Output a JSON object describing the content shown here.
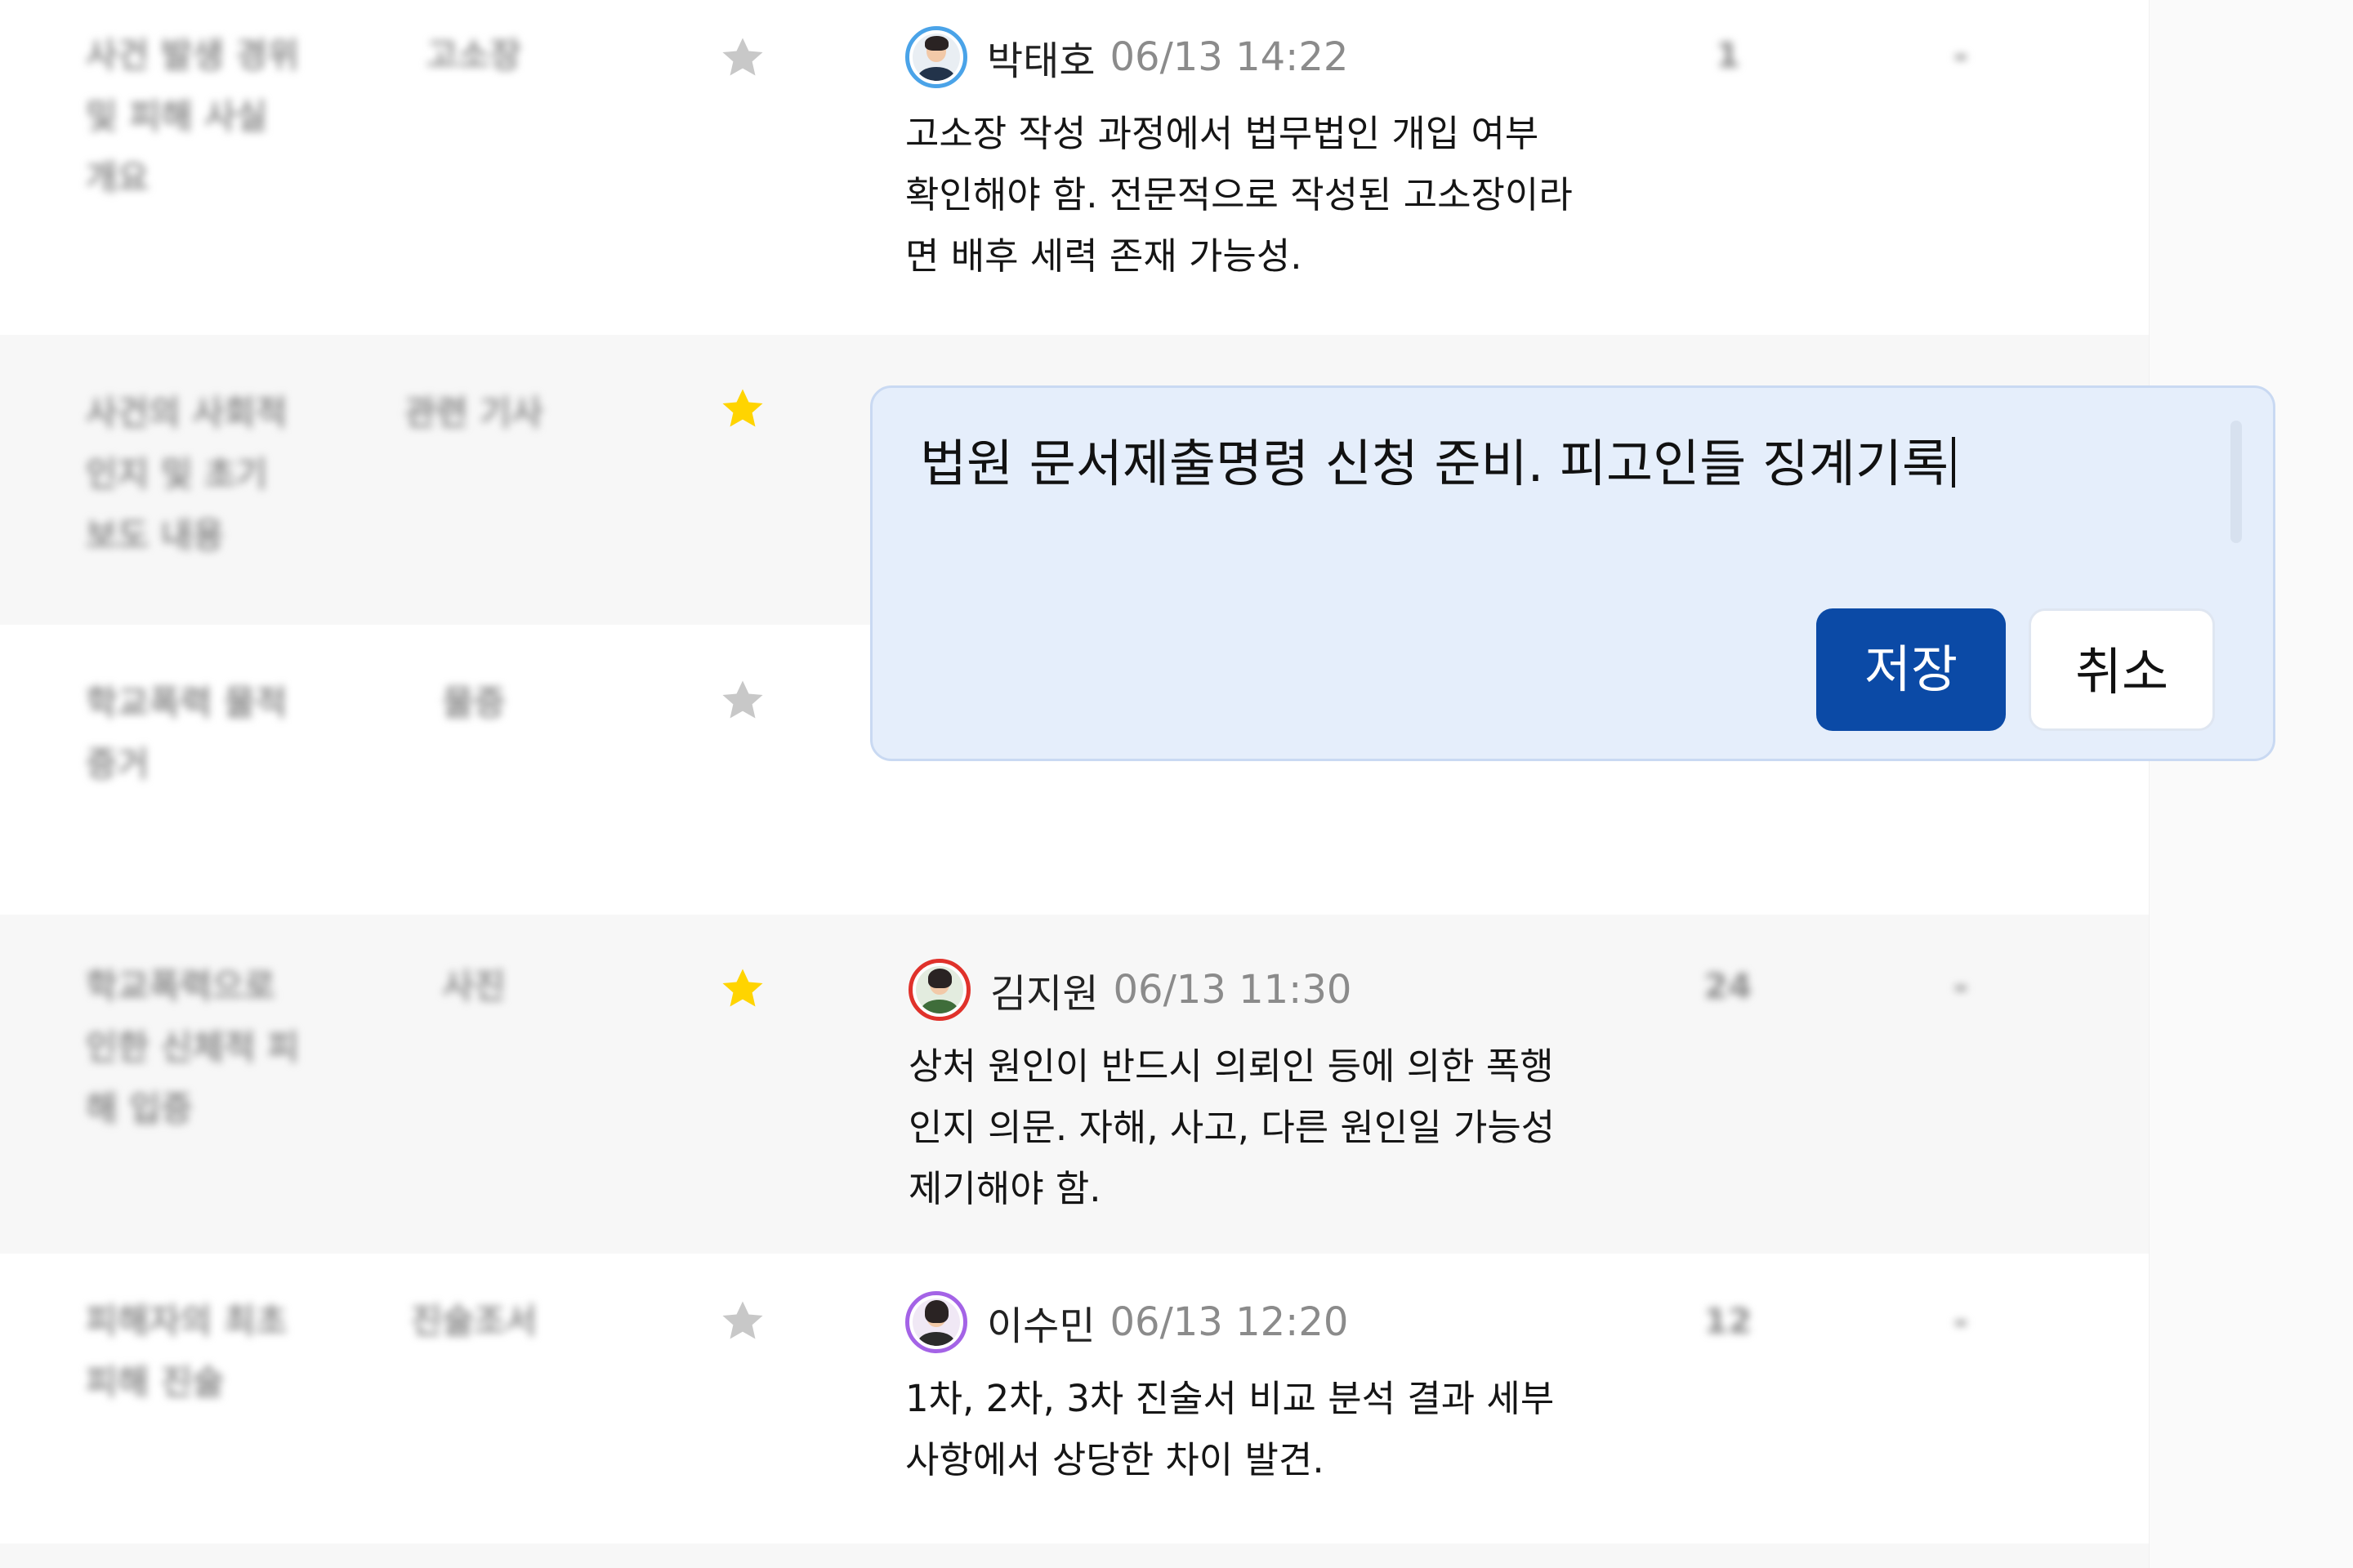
{
  "rows": [
    {
      "description": "사건 발생 경위 및 피해 사실 개요",
      "doc_type": "고소장",
      "starred": false,
      "comment": {
        "author": "박태호",
        "time": "06/13 14:22",
        "text": "고소장 작성 과정에서 법무법인 개입 여부 확인해야 함. 전문적으로 작성된 고소장이라면 배후 세력 존재 가능성."
      },
      "count": "1",
      "extra": "-"
    },
    {
      "description": "사건의 사회적 인지 및 초기 보도 내용",
      "doc_type": "관련 기사",
      "starred": true,
      "comment": null,
      "count": "",
      "extra": ""
    },
    {
      "description": "학교폭력 물적 증거",
      "doc_type": "물증",
      "starred": false,
      "comment": null,
      "count": "",
      "extra": ""
    },
    {
      "description": "학교폭력으로 인한 신체적 피해 입증",
      "doc_type": "사진",
      "starred": true,
      "comment": {
        "author": "김지원",
        "time": "06/13 11:30",
        "text": "상처 원인이 반드시 의뢰인 등에 의한 폭행인지 의문. 자해, 사고, 다른 원인일 가능성 제기해야 함."
      },
      "count": "24",
      "extra": "-"
    },
    {
      "description": "피해자의 최초 피해 진술",
      "doc_type": "진술조서",
      "starred": false,
      "comment": {
        "author": "이수민",
        "time": "06/13 12:20",
        "text": "1차, 2차, 3차 진술서 비교 분석 결과 세부 사항에서 상당한 차이 발견."
      },
      "count": "12",
      "extra": "-"
    }
  ],
  "editor": {
    "value": "법원 문서제출명령 신청 준비. 피고인들 징계기록",
    "save_label": "저장",
    "cancel_label": "취소"
  },
  "colors": {
    "star_active": "#ffd400",
    "star_inactive": "#c8c8c8",
    "primary": "#0b4aa6",
    "editor_bg": "#e5eefb",
    "avatar_blue": "#4aa3e8",
    "avatar_red": "#e0322b",
    "avatar_purple": "#a463e6"
  },
  "icons": {
    "star": "star-icon",
    "avatar": "user-avatar"
  }
}
